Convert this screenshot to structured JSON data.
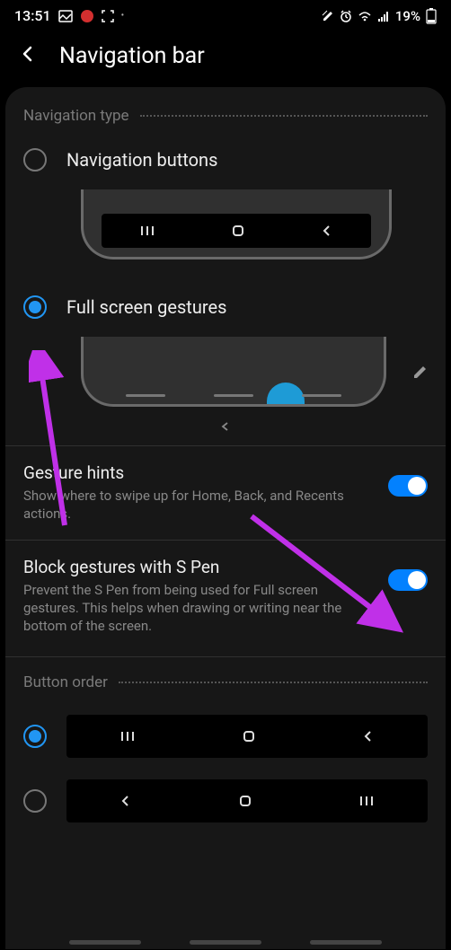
{
  "status": {
    "time": "13:51",
    "battery": "19%"
  },
  "header": {
    "title": "Navigation bar"
  },
  "sections": {
    "nav_type_label": "Navigation type",
    "button_order_label": "Button order"
  },
  "nav_options": {
    "buttons_label": "Navigation buttons",
    "gestures_label": "Full screen gestures"
  },
  "settings": {
    "gesture_hints": {
      "title": "Gesture hints",
      "desc": "Show where to swipe up for Home, Back, and Recents actions."
    },
    "block_spen": {
      "title": "Block gestures with S Pen",
      "desc": "Prevent the S Pen from being used for Full screen gestures. This helps when drawing or writing near the bottom of the screen."
    }
  }
}
